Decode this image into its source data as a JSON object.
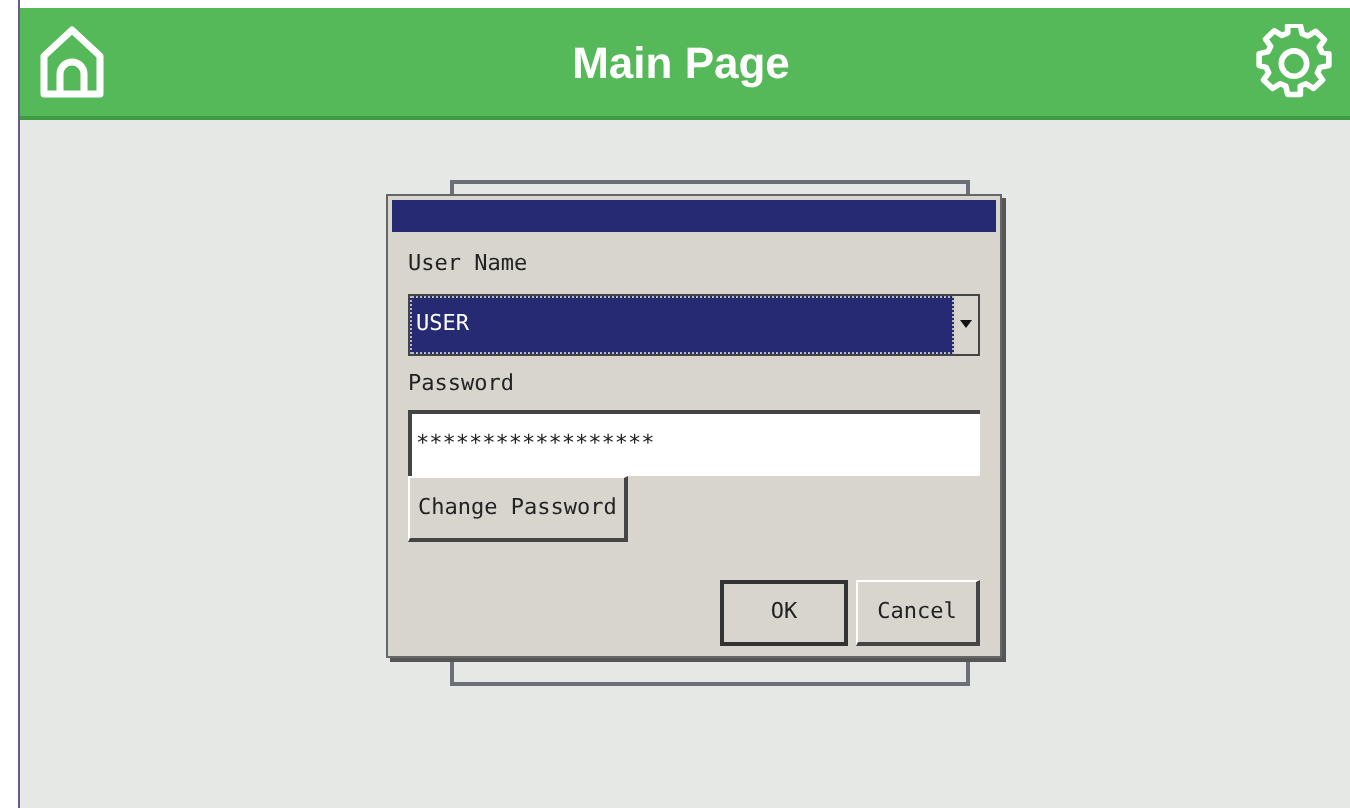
{
  "header": {
    "title": "Main Page"
  },
  "dialog": {
    "user_label": "User Name",
    "user_value": "USER",
    "password_label": "Password",
    "password_value": "******************",
    "change_button": "Change Password",
    "buttons": [
      "OK",
      "Cancel"
    ]
  }
}
